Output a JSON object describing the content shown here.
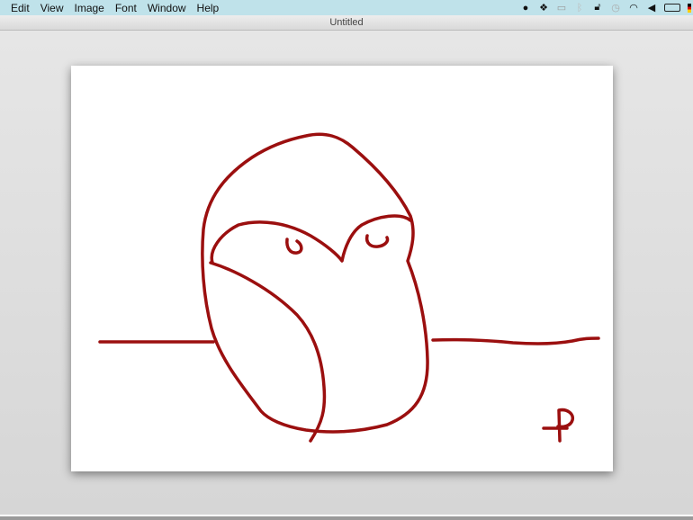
{
  "menubar": {
    "items": [
      "Edit",
      "View",
      "Image",
      "Font",
      "Window",
      "Help"
    ],
    "tray_icons": [
      "evernote-icon",
      "dropbox-icon",
      "keyboard-input-icon",
      "bluetooth-icon",
      "lock-icon",
      "time-machine-icon",
      "wifi-icon",
      "volume-icon",
      "battery-icon",
      "flag-icon"
    ]
  },
  "window": {
    "title": "Untitled"
  },
  "drawing": {
    "stroke_color": "#9b0f0f",
    "signature": "P"
  }
}
